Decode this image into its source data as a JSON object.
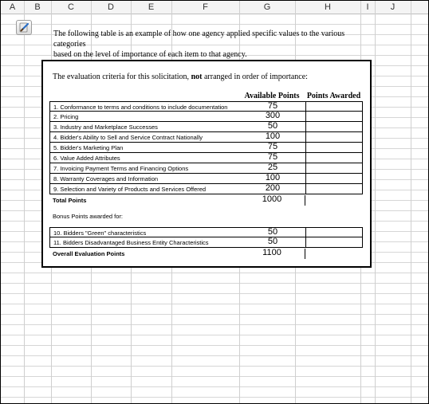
{
  "columns": [
    "A",
    "B",
    "C",
    "D",
    "E",
    "F",
    "G",
    "H",
    "I",
    "J"
  ],
  "intro_line1": "The following table is an example of how one agency applied specific values to the various categories",
  "intro_line2": "based on the level of importance of each item to that agency.",
  "table": {
    "heading_pre": "The evaluation criteria for this solicitation, ",
    "heading_bold": "not",
    "heading_post": " arranged in order of importance:",
    "col_available": "Available Points",
    "col_awarded": "Points Awarded",
    "rows": [
      {
        "label": "1. Conformance to terms and conditions to include documentation",
        "points": "75"
      },
      {
        "label": "2. Pricing",
        "points": "300"
      },
      {
        "label": "3. Industry and Marketplace Successes",
        "points": "50"
      },
      {
        "label": "4. Bidder's Ability to Sell and Service Contract Nationally",
        "points": "100"
      },
      {
        "label": "5. Bidder's Marketing Plan",
        "points": "75"
      },
      {
        "label": "6. Value Added Attributes",
        "points": "75"
      },
      {
        "label": "7. Invoicing Payment Terms and Financing Options",
        "points": "25"
      },
      {
        "label": "8. Warranty Coverages and Information",
        "points": "100"
      },
      {
        "label": "9. Selection and Variety of Products and Services Offered",
        "points": "200"
      }
    ],
    "total_label": "Total Points",
    "total_points": "1000",
    "bonus_heading": "Bonus Points awarded for:",
    "bonus_rows": [
      {
        "label": "10. Bidders \"Green\" characteristics",
        "points": "50"
      },
      {
        "label": "11. Bidders Disadvantaged Business Entity Characteristics",
        "points": "50"
      }
    ],
    "overall_label": "Overall Evaluation Points",
    "overall_points": "1100"
  }
}
